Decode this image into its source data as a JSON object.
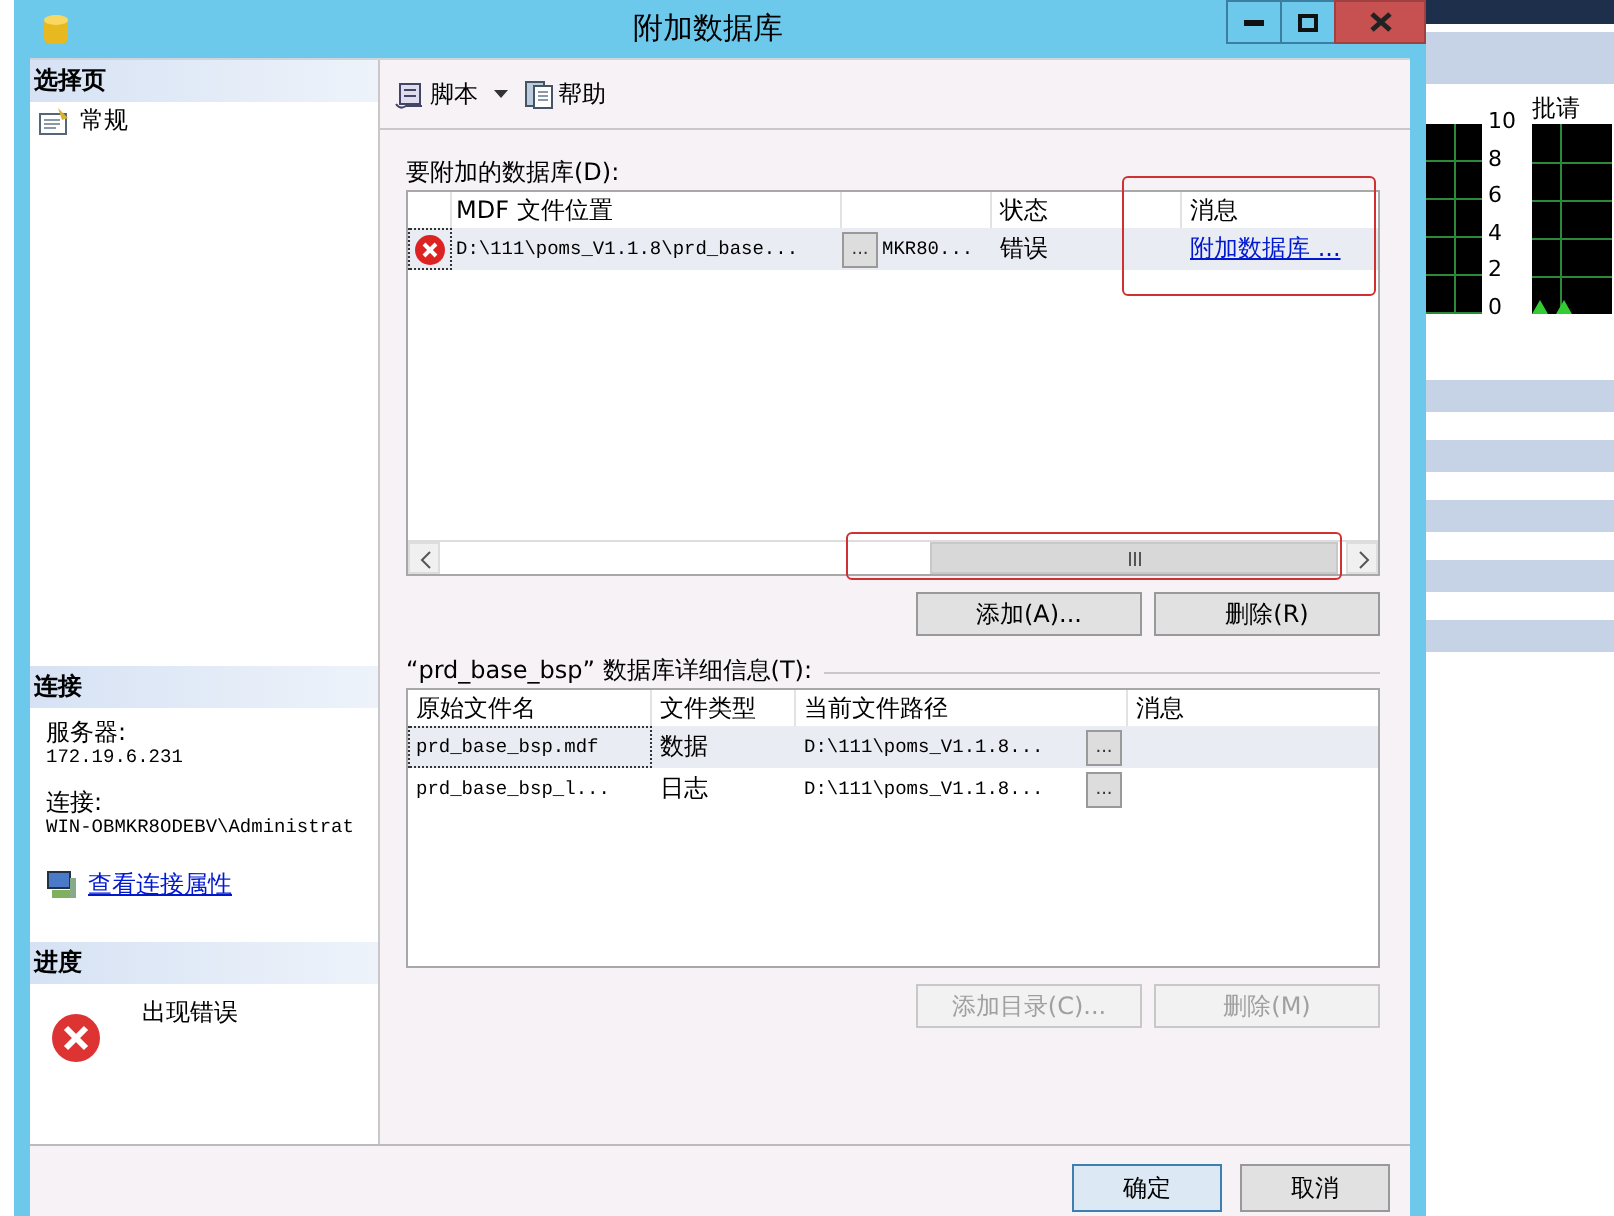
{
  "window": {
    "title": "附加数据库"
  },
  "sidebar": {
    "header": "选择页",
    "items": [
      {
        "label": "常规",
        "selected": false
      }
    ]
  },
  "connection": {
    "header": "连接",
    "server_label": "服务器:",
    "server": "172.19.6.231",
    "connection_label": "连接:",
    "connection": "WIN-OBMKR8ODEBV\\Administrat",
    "link": "查看连接属性"
  },
  "progress": {
    "header": "进度",
    "status": "出现错误"
  },
  "toolbar": [
    {
      "label": "脚本",
      "kind": "script",
      "dropdown": true
    },
    {
      "label": "帮助",
      "kind": "help",
      "dropdown": false
    }
  ],
  "databases": {
    "label": "要附加的数据库(D):",
    "columns": [
      "MDF 文件位置",
      "状态",
      "消息"
    ],
    "rows": [
      {
        "error": true,
        "mdf": "D:\\111\\poms_V1.1.8\\prd_base...",
        "browse": "...",
        "column_3": "MKR80...",
        "status": "错误",
        "message": "附加数据库 ...",
        "selected": true
      }
    ],
    "buttons": [
      {
        "label": "添加(A)...",
        "disabled": false
      },
      {
        "label": "删除(R)",
        "disabled": false
      }
    ]
  },
  "details": {
    "label": "“prd_base_bsp” 数据库详细信息(T):",
    "columns": [
      "原始文件名",
      "文件类型",
      "当前文件路径",
      "消息"
    ],
    "rows": [
      {
        "name": "prd_base_bsp.mdf",
        "type": "数据",
        "path": "D:\\111\\poms_V1.1.8...",
        "browse": "...",
        "selected": true
      },
      {
        "name": "prd_base_bsp_l...",
        "type": "日志",
        "path": "D:\\111\\poms_V1.1.8...",
        "browse": "...",
        "selected": false
      }
    ],
    "buttons": [
      {
        "label": "添加目录(C)...",
        "disabled": true
      },
      {
        "label": "删除(M)",
        "disabled": true
      }
    ]
  },
  "footer": {
    "buttons": [
      {
        "label": "确定",
        "default": true
      },
      {
        "label": "取消",
        "default": false
      }
    ]
  },
  "background_window": {
    "chart_label": "批请",
    "axis_ticks": [
      "10",
      "8",
      "6",
      "4",
      "2",
      "0"
    ]
  }
}
